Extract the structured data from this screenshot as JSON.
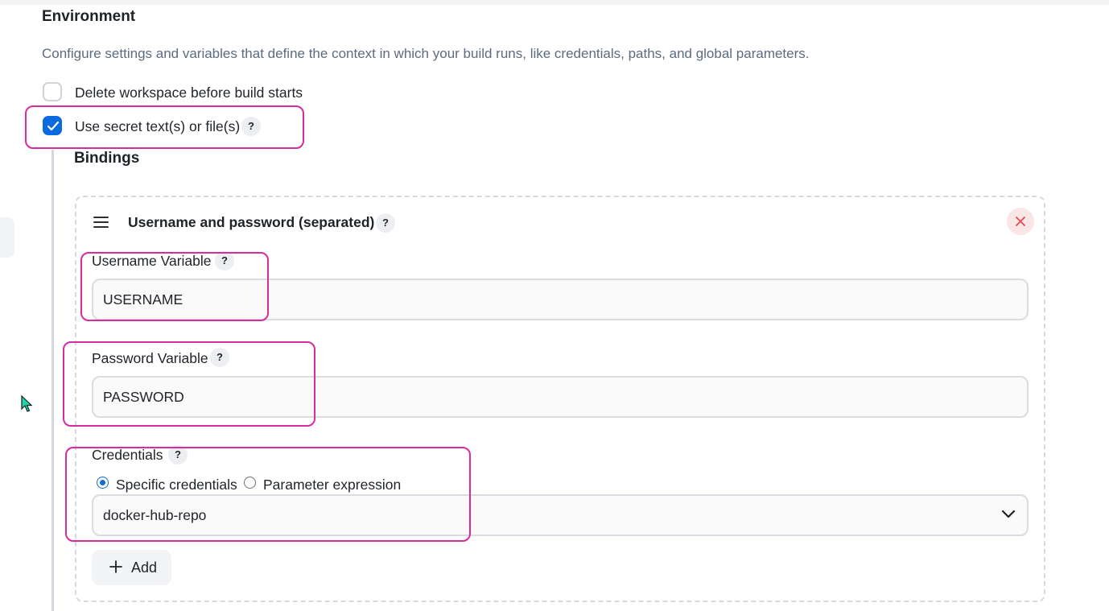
{
  "environment": {
    "title": "Environment",
    "description": "Configure settings and variables that define the context in which your build runs, like credentials, paths, and global parameters.",
    "options": [
      {
        "label": "Delete workspace before build starts",
        "checked": false
      },
      {
        "label": "Use secret text(s) or file(s)",
        "checked": true
      }
    ]
  },
  "help_glyph": "?",
  "bindings": {
    "title": "Bindings",
    "item": {
      "name": "Username and password (separated)",
      "username_label": "Username Variable",
      "username_value": "USERNAME",
      "password_label": "Password Variable",
      "password_value": "PASSWORD",
      "credentials_label": "Credentials",
      "credentials_modes": [
        {
          "label": "Specific credentials",
          "selected": true
        },
        {
          "label": "Parameter expression",
          "selected": false
        }
      ],
      "credentials_value": "docker-hub-repo"
    },
    "add_label": "Add"
  },
  "colors": {
    "accent": "#0b6bde",
    "highlight": "#d82ba0",
    "remove": "#e5484d"
  }
}
